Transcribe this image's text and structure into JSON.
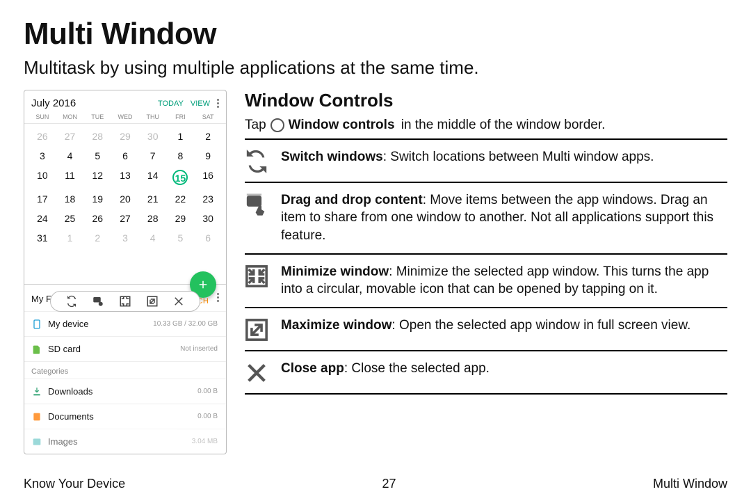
{
  "page": {
    "title": "Multi Window",
    "subtitle": "Multitask by using multiple applications at the same time."
  },
  "mock": {
    "calendar": {
      "month": "July 2016",
      "today_label": "TODAY",
      "view_label": "VIEW",
      "dow": [
        "SUN",
        "MON",
        "TUE",
        "WED",
        "THU",
        "FRI",
        "SAT"
      ],
      "weeks": [
        {
          "days": [
            "26",
            "27",
            "28",
            "29",
            "30",
            "1",
            "2"
          ],
          "faded_upto": 4
        },
        {
          "days": [
            "3",
            "4",
            "5",
            "6",
            "7",
            "8",
            "9"
          ],
          "faded_upto": -1
        },
        {
          "days": [
            "10",
            "11",
            "12",
            "13",
            "14",
            "15",
            "16"
          ],
          "faded_upto": -1,
          "today_index": 5
        },
        {
          "days": [
            "17",
            "18",
            "19",
            "20",
            "21",
            "22",
            "23"
          ],
          "faded_upto": -1
        },
        {
          "days": [
            "24",
            "25",
            "26",
            "27",
            "28",
            "29",
            "30"
          ],
          "faded_upto": -1
        },
        {
          "days": [
            "31",
            "1",
            "2",
            "3",
            "4",
            "5",
            "6"
          ],
          "faded_from": 1
        }
      ]
    },
    "files": {
      "title": "My Files",
      "search_label": "SEARCH",
      "storage": [
        {
          "name": "My device",
          "sub": "10.33 GB / 32.00 GB"
        },
        {
          "name": "SD card",
          "sub": "Not inserted"
        }
      ],
      "categories_label": "Categories",
      "categories": [
        {
          "name": "Downloads",
          "sub": "0.00 B"
        },
        {
          "name": "Documents",
          "sub": "0.00 B"
        },
        {
          "name": "Images",
          "sub": "3.04 MB"
        }
      ]
    }
  },
  "section": {
    "heading": "Window Controls",
    "intro_pre": "Tap",
    "intro_bold": "Window controls",
    "intro_post": "in the middle of the window border."
  },
  "definitions": [
    {
      "bold": "Switch windows",
      "rest": ": Switch locations between Multi window apps."
    },
    {
      "bold": "Drag and drop content",
      "rest": ": Move items between the app windows. Drag an item to share from one window to another. Not all applications support this feature."
    },
    {
      "bold": "Minimize window",
      "rest": ": Minimize the selected app window. This turns the app into a circular, movable icon that can be opened by tapping on it."
    },
    {
      "bold": "Maximize window",
      "rest": ": Open the selected app window in full screen view."
    },
    {
      "bold": "Close app",
      "rest": ": Close the selected app."
    }
  ],
  "footer": {
    "left": "Know Your Device",
    "page": "27",
    "right": "Multi Window"
  }
}
